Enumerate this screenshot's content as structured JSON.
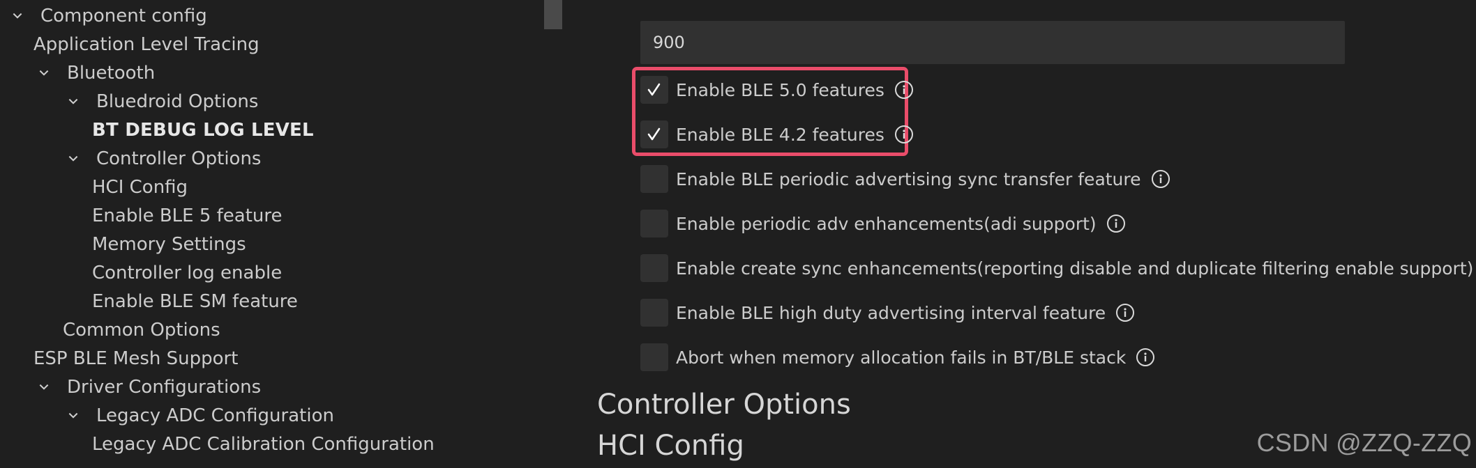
{
  "tree": {
    "items": [
      {
        "label": "Component config",
        "chevron": "chevron-down-icon"
      },
      {
        "label": "Application Level Tracing",
        "chevron": ""
      },
      {
        "label": "Bluetooth",
        "chevron": "chevron-down-icon"
      },
      {
        "label": "Bluedroid Options",
        "chevron": "chevron-down-icon"
      },
      {
        "label": "BT DEBUG LOG LEVEL",
        "chevron": ""
      },
      {
        "label": "Controller Options",
        "chevron": "chevron-down-icon"
      },
      {
        "label": "HCI Config",
        "chevron": ""
      },
      {
        "label": "Enable BLE 5 feature",
        "chevron": ""
      },
      {
        "label": "Memory Settings",
        "chevron": ""
      },
      {
        "label": "Controller log enable",
        "chevron": ""
      },
      {
        "label": "Enable BLE SM feature",
        "chevron": ""
      },
      {
        "label": "Common Options",
        "chevron": ""
      },
      {
        "label": "ESP BLE Mesh Support",
        "chevron": ""
      },
      {
        "label": "Driver Configurations",
        "chevron": "chevron-down-icon"
      },
      {
        "label": "Legacy ADC Configuration",
        "chevron": "chevron-down-icon"
      },
      {
        "label": "Legacy ADC Calibration Configuration",
        "chevron": ""
      }
    ]
  },
  "settings": {
    "number_value": "900",
    "checkboxes": [
      {
        "label": "Enable BLE 5.0 features",
        "checked": true,
        "icon": "info-icon"
      },
      {
        "label": "Enable BLE 4.2 features",
        "checked": true,
        "icon": "info-icon"
      },
      {
        "label": "Enable BLE periodic advertising sync transfer feature",
        "checked": false,
        "icon": "info-icon"
      },
      {
        "label": "Enable periodic adv enhancements(adi support)",
        "checked": false,
        "icon": "info-icon"
      },
      {
        "label": "Enable create sync enhancements(reporting disable and duplicate filtering enable support)",
        "checked": false,
        "icon": "info-icon"
      },
      {
        "label": "Enable BLE high duty advertising interval feature",
        "checked": false,
        "icon": "info-icon"
      },
      {
        "label": "Abort when memory allocation fails in BT/BLE stack",
        "checked": false,
        "icon": "info-icon"
      }
    ],
    "sections": [
      {
        "title": "Controller Options"
      },
      {
        "title": "HCI Config"
      }
    ],
    "highlight_color": "#ea4d6a"
  },
  "watermark": {
    "text": "CSDN @ZZQ-ZZQ"
  }
}
